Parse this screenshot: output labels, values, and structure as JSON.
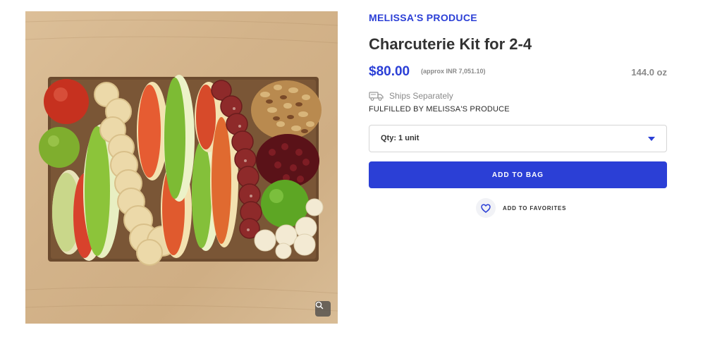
{
  "product": {
    "brand": "MELISSA'S PRODUCE",
    "title": "Charcuterie Kit for 2-4",
    "price": "$80.00",
    "price_approx": "(approx INR 7,051.10)",
    "weight": "144.0 oz",
    "shipping": "Ships Separately",
    "fulfilled_by": "FULFILLED BY MELISSA'S PRODUCE"
  },
  "quantity": {
    "selected": "Qty: 1 unit"
  },
  "actions": {
    "add_to_bag": "ADD TO BAG",
    "add_to_favorites": "ADD TO FAVORITES"
  },
  "image": {
    "description_icon": "zoom-icon"
  },
  "colors": {
    "accent": "#2b3fd6",
    "muted": "#8a8a8a",
    "text": "#333333"
  }
}
